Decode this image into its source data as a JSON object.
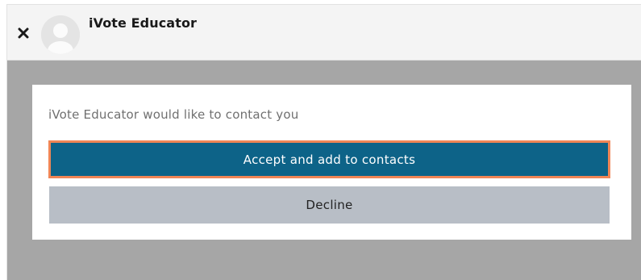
{
  "header": {
    "title": "iVote Educator",
    "close_icon": "close-icon",
    "avatar_icon": "default-user-avatar"
  },
  "dialog": {
    "message": "iVote Educator would like to contact you",
    "accept_label": "Accept and add to contacts",
    "decline_label": "Decline"
  },
  "colors": {
    "accept_bg": "#0d6388",
    "accept_focus_border": "#f08656",
    "decline_bg": "#b8bec6",
    "overlay": "#a6a6a6",
    "header_bg": "#f4f4f4"
  }
}
